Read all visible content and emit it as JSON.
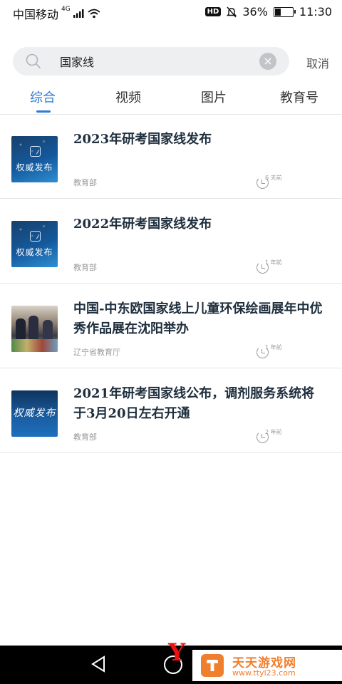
{
  "status_bar": {
    "carrier": "中国移动",
    "network": "4G",
    "hd": "HD",
    "battery": "36%",
    "battery_level": 0.36,
    "time": "11:30"
  },
  "search": {
    "query": "国家线",
    "cancel_label": "取消"
  },
  "tabs": [
    {
      "label": "综合",
      "active": true
    },
    {
      "label": "视频",
      "active": false
    },
    {
      "label": "图片",
      "active": false
    },
    {
      "label": "教育号",
      "active": false
    }
  ],
  "results": [
    {
      "title": "2023年研考国家线发布",
      "source": "教育部",
      "time": "6 天前",
      "thumb_label": "权威发布"
    },
    {
      "title": "2022年研考国家线发布",
      "source": "教育部",
      "time": "1 年前",
      "thumb_label": "权威发布"
    },
    {
      "title": "中国-中东欧国家线上儿童环保绘画展年中优秀作品展在沈阳举办",
      "source": "辽宁省教育厅",
      "time": "1 年前"
    },
    {
      "title": "2021年研考国家线公布，调剂服务系统将于3月20日左右开通",
      "source": "教育部",
      "time": "2 年前",
      "thumb_label": "权威发布"
    }
  ],
  "watermark": {
    "name": "天天游戏网",
    "url": "www.ttyl23.com"
  },
  "colors": {
    "accent": "#2b7cd3",
    "watermark": "#f07f2d"
  }
}
